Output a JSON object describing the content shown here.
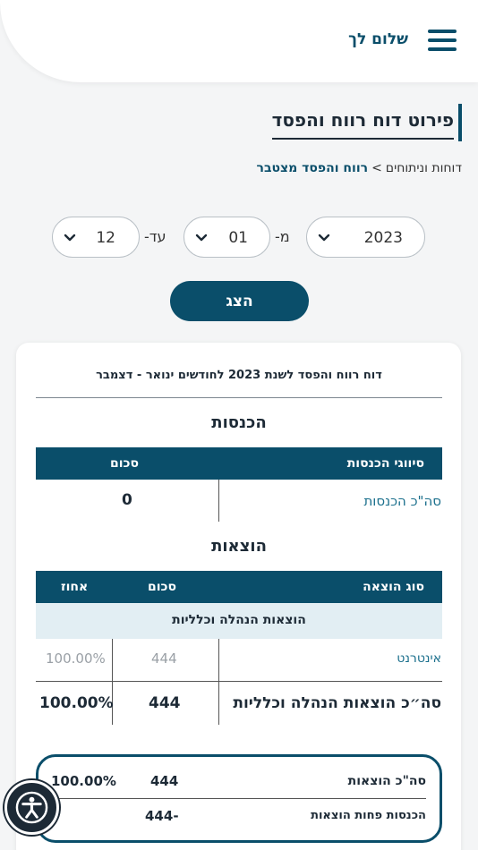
{
  "header": {
    "greeting": "שלום לך",
    "menu_icon": "hamburger-icon"
  },
  "page": {
    "title": "פירוט דוח רווח והפסד",
    "breadcrumb": {
      "parent": "דוחות וניתוחים",
      "separator": ">",
      "current": "רווח והפסד מצטבר"
    }
  },
  "filters": {
    "year": "2023",
    "from_label": "מ-",
    "from_month": "01",
    "to_label": "עד-",
    "to_month": "12",
    "show_button": "הצג"
  },
  "report": {
    "heading": "דוח רווח והפסד לשנת 2023 לחודשים ינואר - דצמבר",
    "income": {
      "title": "הכנסות",
      "columns": [
        "סיווגי הכנסות",
        "סכום"
      ],
      "total_label": "סה\"כ הכנסות",
      "total_value": "0"
    },
    "expenses": {
      "title": "הוצאות",
      "columns": [
        "סוג הוצאה",
        "סכום",
        "אחוז"
      ],
      "group_label": "הוצאות הנהלה וכלליות",
      "rows": [
        {
          "type": "אינטרנט",
          "amount": "444",
          "percent": "100.00%"
        }
      ],
      "group_total_label": "סה״כ הוצאות הנהלה וכלליות",
      "group_total_amount": "444",
      "group_total_percent": "100.00%"
    },
    "summary": {
      "total_expenses_label": "סה\"כ הוצאות",
      "total_expenses_amount": "444",
      "total_expenses_percent": "100.00%",
      "net_label": "הכנסות פחות הוצאות",
      "net_amount": "-444"
    }
  },
  "colors": {
    "brand": "#0a4e6a",
    "link": "#1a6f8c",
    "group_row_bg": "#e2eef3",
    "page_bg": "#f4f5f6"
  },
  "accessibility": {
    "icon": "accessibility-icon"
  }
}
